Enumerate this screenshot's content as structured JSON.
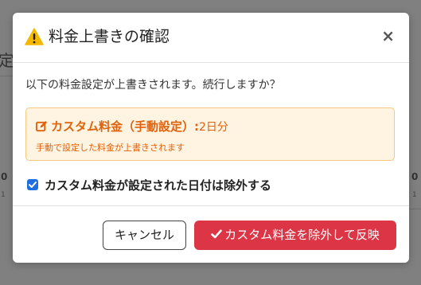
{
  "dialog": {
    "title": "料金上書きの確認",
    "close_symbol": "×",
    "message": "以下の料金設定が上書きされます。続行しますか？",
    "alert": {
      "icon": "edit-icon",
      "label": "カスタム料金（手動設定）:",
      "value": "2日分",
      "note": "手動で設定した料金が上書きされます",
      "color": "#e0620a",
      "background": "#fff3e1"
    },
    "checkbox": {
      "checked": true,
      "label": "カスタム料金が設定された日付は除外する"
    },
    "buttons": {
      "cancel": "キャンセル",
      "confirm": "カスタム料金を除外して反映",
      "confirm_color": "#dc3545"
    }
  },
  "background": {
    "fragments": [
      "定",
      "0",
      "1",
      "0",
      "1"
    ]
  }
}
